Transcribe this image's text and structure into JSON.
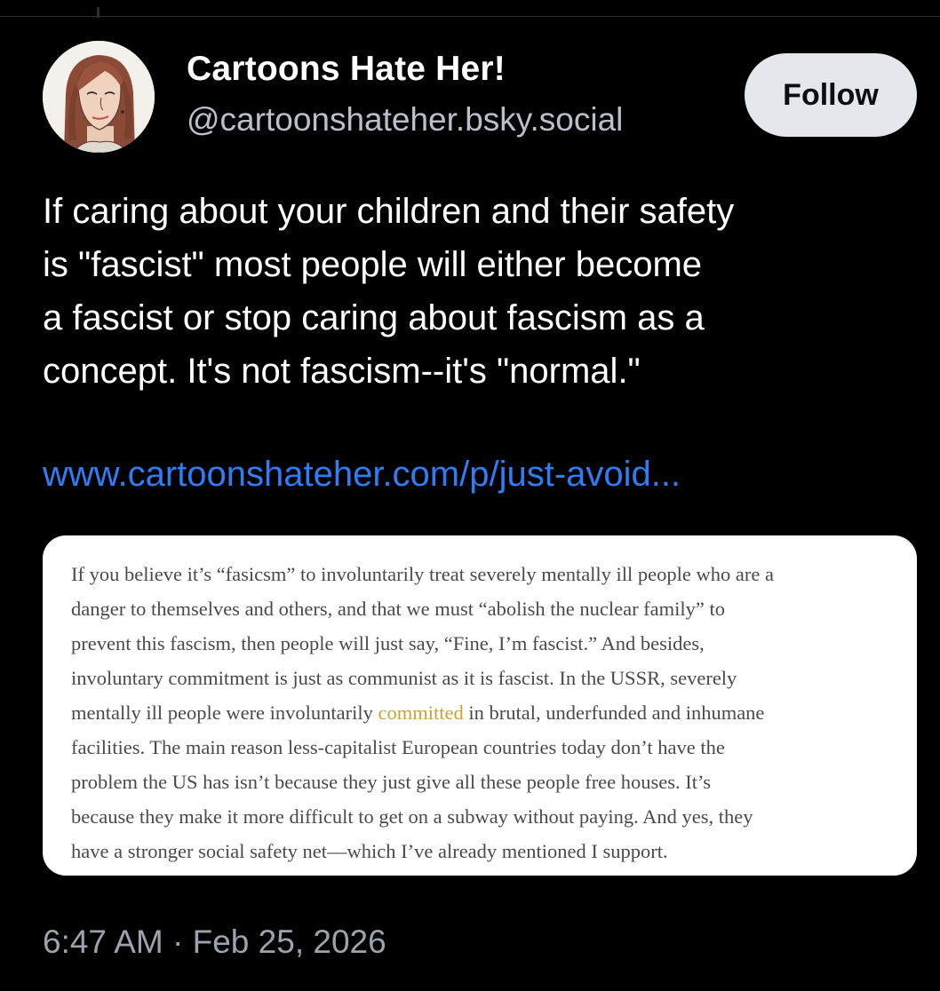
{
  "author": {
    "display_name": "Cartoons Hate Her!",
    "handle": "@cartoonshateher.bsky.social",
    "avatar_icon": "illustrated-woman-portrait"
  },
  "follow_button": {
    "label": "Follow"
  },
  "post": {
    "text_lines": [
      "If caring about your children and their safety",
      "is \"fascist\" most people will either become",
      "a fascist or stop caring about fascism as a",
      "concept. It's not fascism--it's \"normal.\""
    ],
    "link_text": "www.cartoonshateher.com/p/just-avoid..."
  },
  "embed": {
    "lines": [
      {
        "text": "If you believe it’s “fasicsm” to involuntarily treat severely mentally ill people who are a"
      },
      {
        "text": "danger to themselves and others, and that we must “abolish the nuclear family” to"
      },
      {
        "text": "prevent this fascism, then people will just say, “Fine, I’m fascist.” And besides,"
      },
      {
        "text": "involuntary commitment is just as communist as it is fascist. In the USSR, severely"
      },
      {
        "before": "mentally ill people were involuntarily ",
        "link": "committed",
        "after": " in brutal, underfunded and inhumane"
      },
      {
        "text": "facilities. The main reason less-capitalist European countries today don’t have the"
      },
      {
        "text": "problem the US has isn’t because they just give all these people free houses. It’s"
      },
      {
        "text": "because they make it more difficult to get on a subway without paying. And yes, they"
      },
      {
        "text": "have a stronger social safety net—which I’ve already mentioned I support."
      }
    ]
  },
  "timestamp": "6:47 AM · Feb 25, 2026",
  "colors": {
    "background": "#000000",
    "link": "#2f7cf5",
    "handle": "#b9c0cb",
    "follow_bg": "#e4e7ec",
    "embed_highlight": "#c9a33a"
  }
}
